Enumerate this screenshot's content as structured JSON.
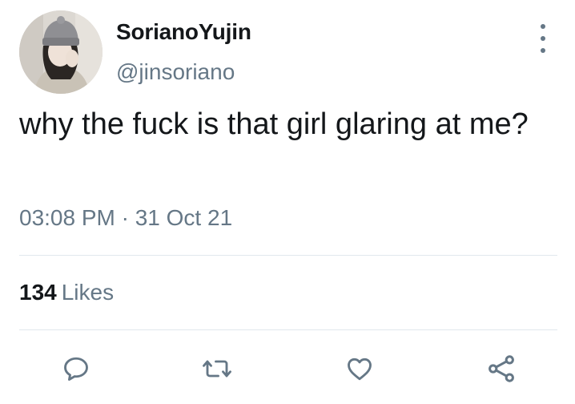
{
  "user": {
    "display_name": "SorianoYujin",
    "handle": "@jinsoriano"
  },
  "tweet": {
    "text": "why the fuck is that girl glaring at me?",
    "timestamp": "03:08 PM · 31 Oct 21"
  },
  "stats": {
    "likes_count": "134",
    "likes_label": "Likes"
  },
  "icons": {
    "menu": "more-vertical-icon",
    "reply": "reply-icon",
    "retweet": "retweet-icon",
    "like": "heart-icon",
    "share": "share-icon"
  },
  "colors": {
    "text_primary": "#14171a",
    "text_secondary": "#657786",
    "divider": "#e1e8ed"
  }
}
